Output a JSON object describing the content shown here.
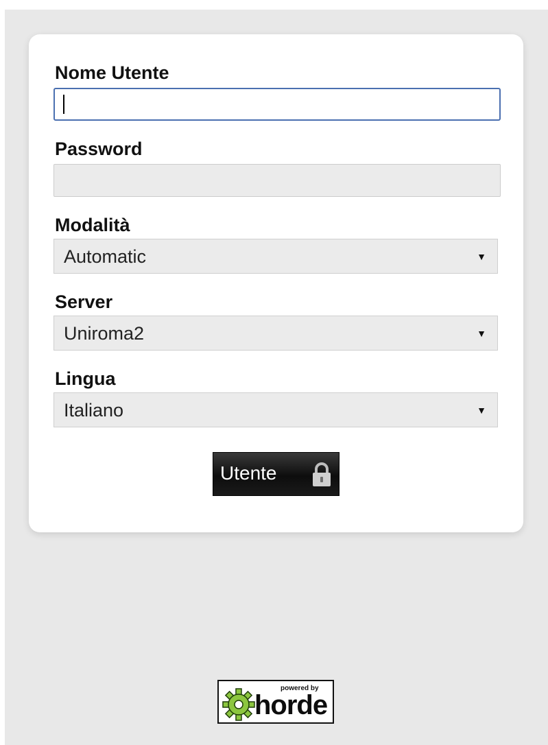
{
  "login_form": {
    "username": {
      "label": "Nome Utente",
      "value": ""
    },
    "password": {
      "label": "Password",
      "value": ""
    },
    "mode": {
      "label": "Modalità",
      "selected": "Automatic"
    },
    "server": {
      "label": "Server",
      "selected": "Uniroma2"
    },
    "language": {
      "label": "Lingua",
      "selected": "Italiano"
    },
    "submit_label": "Utente",
    "submit_icon": "lock-icon"
  },
  "footer": {
    "powered_by_text": "powered by",
    "brand_name": "horde",
    "brand_icon": "gear-icon"
  },
  "colors": {
    "page_background": "#e8e8e8",
    "card_background": "#ffffff",
    "focus_border": "#4a6fb0",
    "field_background": "#ebebeb",
    "button_background": "#111111",
    "logo_green": "#8cc63f"
  }
}
